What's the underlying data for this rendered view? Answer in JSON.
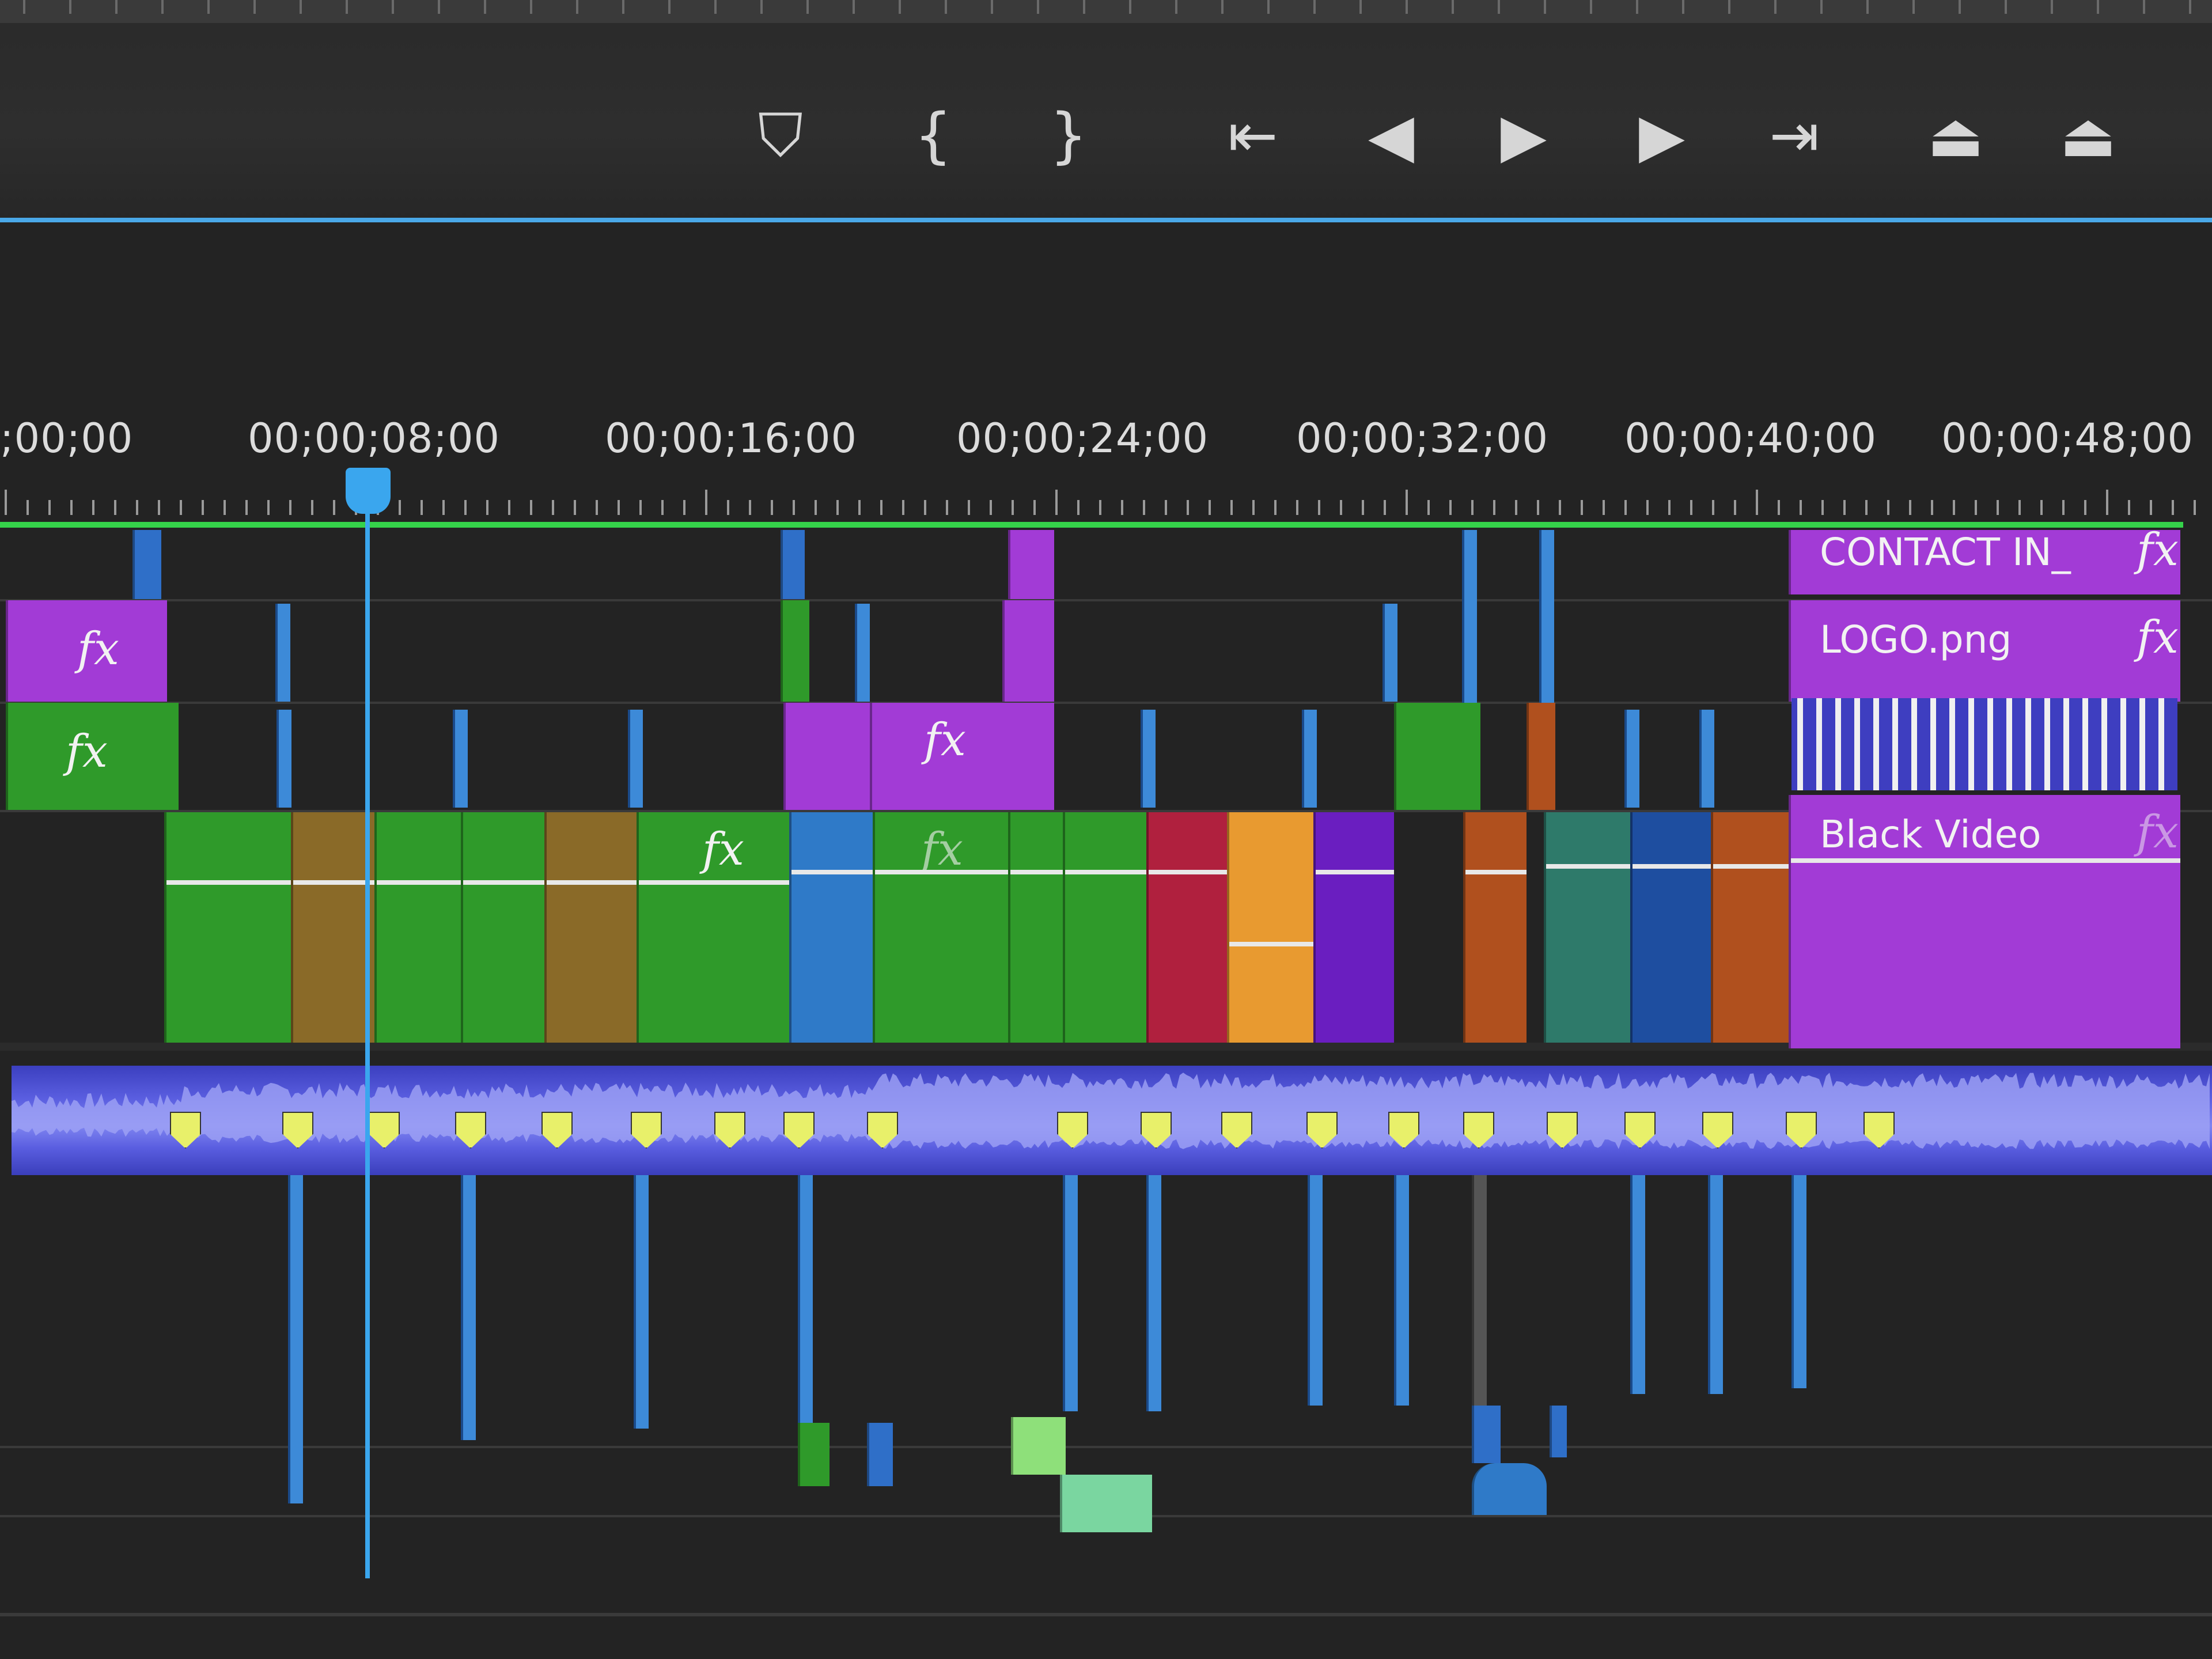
{
  "transport": {
    "buttons": [
      {
        "name": "add-marker-button",
        "icon": "marker-icon",
        "glyph": "⛉"
      },
      {
        "name": "mark-in-button",
        "icon": "mark-in-icon",
        "glyph": "{"
      },
      {
        "name": "mark-out-button",
        "icon": "mark-out-icon",
        "glyph": "}"
      },
      {
        "name": "go-to-in-button",
        "icon": "go-to-in-icon",
        "glyph": "⇤"
      },
      {
        "name": "step-back-button",
        "icon": "step-back-icon",
        "glyph": "◀"
      },
      {
        "name": "play-button",
        "icon": "play-icon",
        "glyph": "▶"
      },
      {
        "name": "step-forward-button",
        "icon": "step-forward-icon",
        "glyph": "▶"
      },
      {
        "name": "go-to-out-button",
        "icon": "go-to-out-icon",
        "glyph": "⇥"
      },
      {
        "name": "lift-button",
        "icon": "lift-icon",
        "glyph": "⏏"
      },
      {
        "name": "extract-button",
        "icon": "extract-icon",
        "glyph": "⏏"
      }
    ]
  },
  "ruler": {
    "timecodes": [
      ";00;00",
      "00;00;08;00",
      "00;00;16;00",
      "00;00;24;00",
      "00;00;32;00",
      "00;00;40;00",
      "00;00;48;00"
    ]
  },
  "clips": {
    "contact": {
      "label": "CONTACT IN_",
      "fx": "fx"
    },
    "logo": {
      "label": "LOGO.png",
      "fx": "fx"
    },
    "black_video": {
      "label": "Black Video",
      "fx": "fx"
    },
    "fx_text": "fx"
  },
  "colors": {
    "accent": "#3aa6ee",
    "purple": "#a23bd6",
    "green": "#2f9a2a",
    "audio": "#5a5ee0"
  }
}
